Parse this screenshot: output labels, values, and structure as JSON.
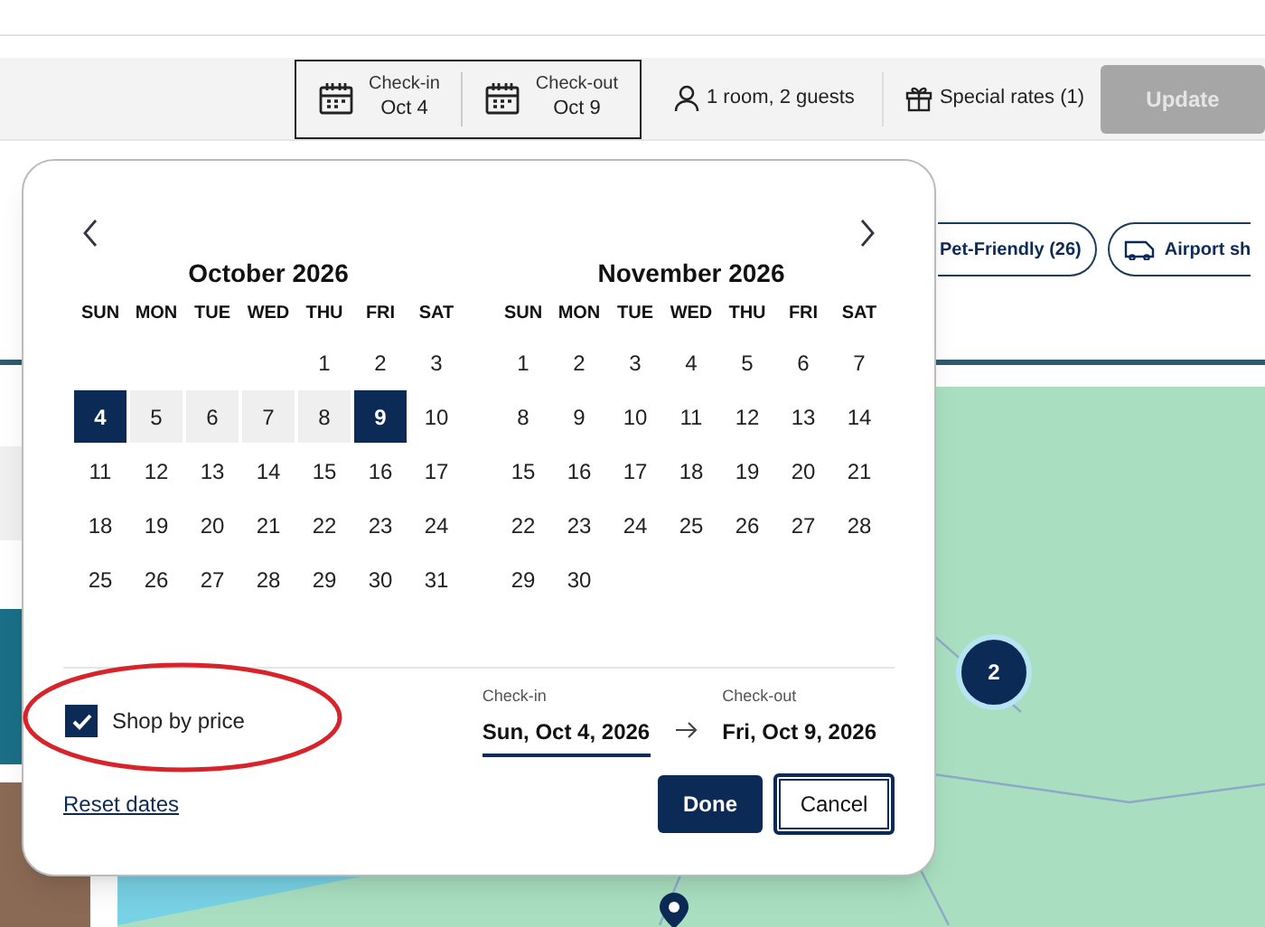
{
  "search_bar": {
    "check_in": {
      "label": "Check-in",
      "value": "Oct 4"
    },
    "check_out": {
      "label": "Check-out",
      "value": "Oct 9"
    },
    "guests": "1 room, 2 guests",
    "special_rates": "Special rates (1)",
    "update_button": {
      "label": "Update",
      "disabled": true
    }
  },
  "filter_chips": [
    "Pet-Friendly (26)",
    "Airport sh"
  ],
  "date_picker": {
    "months": [
      {
        "title": "October 2026",
        "weekdays": [
          "SUN",
          "MON",
          "TUE",
          "WED",
          "THU",
          "FRI",
          "SAT"
        ],
        "weeks": [
          [
            {
              "label": "1",
              "selected": false,
              "in_range": false
            },
            {
              "label": "2",
              "selected": false,
              "in_range": false
            },
            {
              "label": "3",
              "selected": false,
              "in_range": false
            }
          ],
          [
            {
              "label": "4",
              "selected": true
            },
            {
              "label": "5",
              "selected": false,
              "in_range": true
            },
            {
              "label": "6",
              "selected": false,
              "in_range": true
            },
            {
              "label": "7",
              "selected": false,
              "in_range": true
            },
            {
              "label": "8",
              "selected": false,
              "in_range": true
            },
            {
              "label": "9",
              "selected": true
            },
            {
              "label": "10",
              "selected": false,
              "in_range": false
            }
          ],
          [
            {
              "label": "11",
              "selected": false,
              "in_range": false
            },
            {
              "label": "12",
              "selected": false,
              "in_range": false
            },
            {
              "label": "13",
              "selected": false,
              "in_range": false
            },
            {
              "label": "14",
              "selected": false,
              "in_range": false
            },
            {
              "label": "15",
              "selected": false,
              "in_range": false
            },
            {
              "label": "16",
              "selected": false,
              "in_range": false
            },
            {
              "label": "17",
              "selected": false,
              "in_range": false
            }
          ],
          [
            {
              "label": "18",
              "selected": false,
              "in_range": false
            },
            {
              "label": "19",
              "selected": false,
              "in_range": false
            },
            {
              "label": "20",
              "selected": false,
              "in_range": false
            },
            {
              "label": "21",
              "selected": false,
              "in_range": false
            },
            {
              "label": "22",
              "selected": false,
              "in_range": false
            },
            {
              "label": "23",
              "selected": false,
              "in_range": false
            },
            {
              "label": "24",
              "selected": false,
              "in_range": false
            }
          ],
          [
            {
              "label": "25",
              "selected": false,
              "in_range": false
            },
            {
              "label": "26",
              "selected": false,
              "in_range": false
            },
            {
              "label": "27",
              "selected": false,
              "in_range": false
            },
            {
              "label": "28",
              "selected": false,
              "in_range": false
            },
            {
              "label": "29",
              "selected": false,
              "in_range": false
            },
            {
              "label": "30",
              "selected": false,
              "in_range": false
            },
            {
              "label": "31",
              "selected": false,
              "in_range": false
            }
          ]
        ]
      },
      {
        "title": "November 2026",
        "weekdays": [
          "SUN",
          "MON",
          "TUE",
          "WED",
          "THU",
          "FRI",
          "SAT"
        ],
        "weeks": [
          [
            {
              "label": "1",
              "selected": false,
              "in_range": false
            },
            {
              "label": "2",
              "selected": false,
              "in_range": false
            },
            {
              "label": "3",
              "selected": false,
              "in_range": false
            },
            {
              "label": "4",
              "selected": false,
              "in_range": false
            },
            {
              "label": "5",
              "selected": false,
              "in_range": false
            },
            {
              "label": "6",
              "selected": false,
              "in_range": false
            },
            {
              "label": "7",
              "selected": false,
              "in_range": false
            }
          ],
          [
            {
              "label": "8",
              "selected": false,
              "in_range": false
            },
            {
              "label": "9",
              "selected": false,
              "in_range": false
            },
            {
              "label": "10",
              "selected": false,
              "in_range": false
            },
            {
              "label": "11",
              "selected": false,
              "in_range": false
            },
            {
              "label": "12",
              "selected": false,
              "in_range": false
            },
            {
              "label": "13",
              "selected": false,
              "in_range": false
            },
            {
              "label": "14",
              "selected": false,
              "in_range": false
            }
          ],
          [
            {
              "label": "15",
              "selected": false,
              "in_range": false
            },
            {
              "label": "16",
              "selected": false,
              "in_range": false
            },
            {
              "label": "17",
              "selected": false,
              "in_range": false
            },
            {
              "label": "18",
              "selected": false,
              "in_range": false
            },
            {
              "label": "19",
              "selected": false,
              "in_range": false
            },
            {
              "label": "20",
              "selected": false,
              "in_range": false
            },
            {
              "label": "21",
              "selected": false,
              "in_range": false
            }
          ],
          [
            {
              "label": "22",
              "selected": false,
              "in_range": false
            },
            {
              "label": "23",
              "selected": false,
              "in_range": false
            },
            {
              "label": "24",
              "selected": false,
              "in_range": false
            },
            {
              "label": "25",
              "selected": false,
              "in_range": false
            },
            {
              "label": "26",
              "selected": false,
              "in_range": false
            },
            {
              "label": "27",
              "selected": false,
              "in_range": false
            },
            {
              "label": "28",
              "selected": false,
              "in_range": false
            }
          ],
          [
            {
              "label": "29",
              "selected": false,
              "in_range": false
            },
            {
              "label": "30",
              "selected": false,
              "in_range": false
            }
          ]
        ]
      }
    ],
    "shop_by_price": {
      "label": "Shop by price",
      "checked": true
    },
    "check_in": {
      "label": "Check-in",
      "value": "Sun, Oct 4, 2026",
      "selected": true
    },
    "check_out": {
      "label": "Check-out",
      "value": "Fri, Oct 9, 2026",
      "selected": false
    },
    "reset_link": "Reset dates",
    "buttons": {
      "done": "Done",
      "cancel": "Cancel"
    }
  },
  "map": {
    "cluster_marker": "2"
  }
}
